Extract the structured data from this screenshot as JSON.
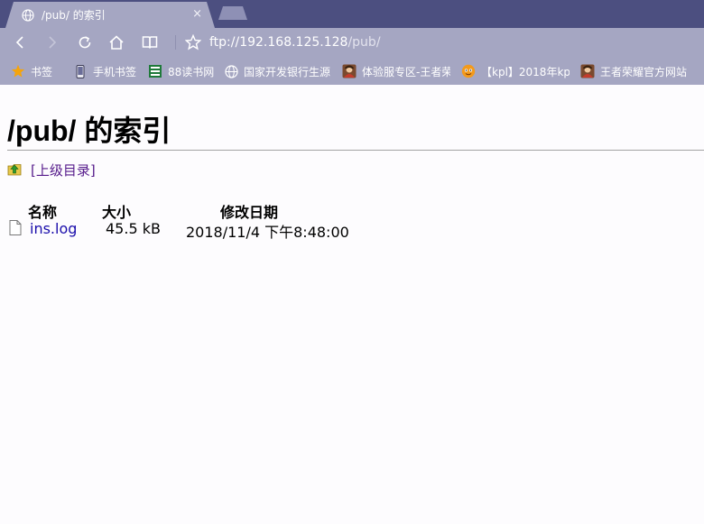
{
  "browser": {
    "tab": {
      "title": "/pub/ 的索引",
      "close": "×"
    },
    "address": {
      "host": "ftp://192.168.125.128",
      "path": "/pub/"
    },
    "bookmarks": [
      {
        "label": "书签",
        "icon": "star-icon"
      },
      {
        "label": "手机书签",
        "icon": "phone-icon"
      },
      {
        "label": "88读书网",
        "icon": "book-icon"
      },
      {
        "label": "国家开发银行生源",
        "icon": "globe-icon"
      },
      {
        "label": "体验服专区-王者荣",
        "icon": "game-avatar-icon"
      },
      {
        "label": "【kpl】2018年kp",
        "icon": "mascot-icon"
      },
      {
        "label": "王者荣耀官方网站",
        "icon": "game-avatar-icon"
      }
    ]
  },
  "listing": {
    "title": "/pub/ 的索引",
    "parent_link": "[上级目录]",
    "columns": {
      "name": "名称",
      "size": "大小",
      "modified": "修改日期"
    },
    "files": [
      {
        "name": "ins.log",
        "size": "45.5 kB",
        "modified": "2018/11/4 下午8:48:00",
        "icon": "file-icon"
      }
    ]
  },
  "colors": {
    "chrome_dark": "#4c4f80",
    "chrome_light": "#a5a6c2",
    "link": "#1a0dab",
    "visited_link": "#551a8b"
  }
}
